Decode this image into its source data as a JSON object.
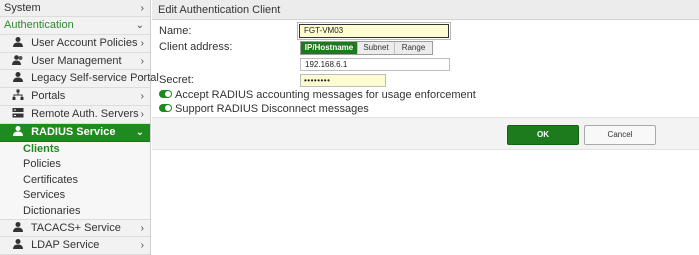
{
  "sidebar": {
    "system": "System",
    "authentication": "Authentication",
    "items": [
      {
        "label": "User Account Policies",
        "icon": "user-icon"
      },
      {
        "label": "User Management",
        "icon": "users-icon"
      },
      {
        "label": "Legacy Self-service Portal",
        "icon": "user-icon"
      },
      {
        "label": "Portals",
        "icon": "network-icon"
      },
      {
        "label": "Remote Auth. Servers",
        "icon": "server-icon"
      },
      {
        "label": "RADIUS Service",
        "icon": "user-icon"
      }
    ],
    "radius_sub": [
      "Clients",
      "Policies",
      "Certificates",
      "Services",
      "Dictionaries"
    ],
    "bottom_items": [
      {
        "label": "TACACS+ Service",
        "icon": "user-icon"
      },
      {
        "label": "LDAP Service",
        "icon": "user-icon"
      }
    ],
    "chevron_right": "›",
    "chevron_down": "⌄"
  },
  "dialog": {
    "title": "Edit Authentication Client",
    "name_label": "Name:",
    "name_value": "FGT-VM03",
    "client_address_label": "Client address:",
    "address_modes": [
      "IP/Hostname",
      "Subnet",
      "Range"
    ],
    "address_mode_selected": "IP/Hostname",
    "ip_value": "192.168.6.1",
    "secret_label": "Secret:",
    "secret_value": "••••••••",
    "accounting_toggle_label": "Accept RADIUS accounting messages for usage enforcement",
    "accounting_enabled": true,
    "disconnect_toggle_label": "Support RADIUS Disconnect messages",
    "disconnect_enabled": true,
    "ok_label": "OK",
    "cancel_label": "Cancel"
  },
  "colors": {
    "accent_green": "#1f8a1f",
    "section_green": "#2e8b2e",
    "input_yellow": "#fdfbd0"
  }
}
